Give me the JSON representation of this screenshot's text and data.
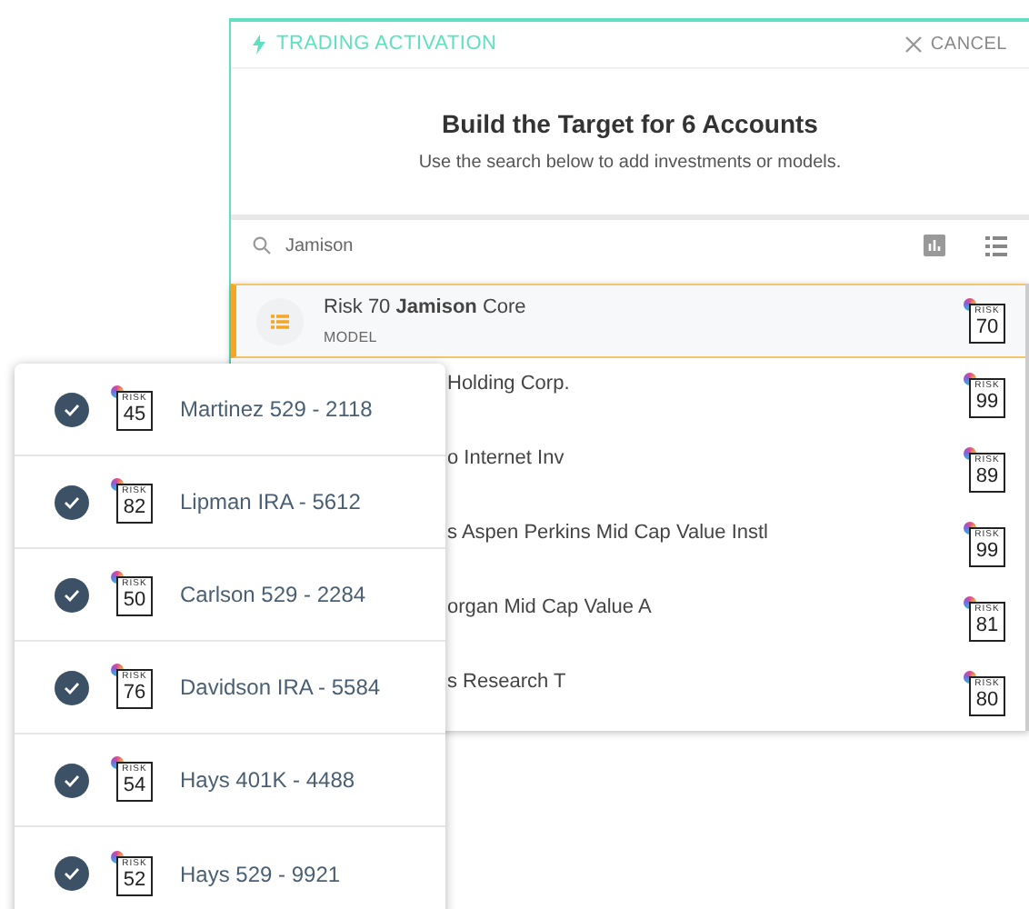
{
  "header": {
    "title": "TRADING ACTIVATION",
    "cancel": "CANCEL"
  },
  "heading": {
    "title": "Build the Target for 6 Accounts",
    "subtitle": "Use the search below to add investments or models."
  },
  "search": {
    "value": "Jamison"
  },
  "results": [
    {
      "name": "Risk 70 **Jamison** Core",
      "type": "MODEL",
      "selected": true,
      "risk_label": "RISK",
      "risk": "70"
    },
    {
      "name": "Holding Corp.",
      "selected": false,
      "risk_label": "RISK",
      "risk": "99"
    },
    {
      "name": "o Internet Inv",
      "selected": false,
      "risk_label": "RISK",
      "risk": "89"
    },
    {
      "name": "s Aspen Perkins Mid Cap Value Instl",
      "selected": false,
      "risk_label": "RISK",
      "risk": "99"
    },
    {
      "name": "organ Mid Cap Value A",
      "selected": false,
      "risk_label": "RISK",
      "risk": "81"
    },
    {
      "name": "s Research T",
      "selected": false,
      "risk_label": "RISK",
      "risk": "80"
    }
  ],
  "accounts": [
    {
      "name": "Martinez 529 - 2118",
      "checked": true,
      "risk_label": "RISK",
      "risk": "45"
    },
    {
      "name": "Lipman IRA - 5612",
      "checked": true,
      "risk_label": "RISK",
      "risk": "82"
    },
    {
      "name": "Carlson 529 - 2284",
      "checked": true,
      "risk_label": "RISK",
      "risk": "50"
    },
    {
      "name": "Davidson IRA - 5584",
      "checked": true,
      "risk_label": "RISK",
      "risk": "76"
    },
    {
      "name": "Hays 401K - 4488",
      "checked": true,
      "risk_label": "RISK",
      "risk": "54"
    },
    {
      "name": "Hays 529 - 9921",
      "checked": true,
      "risk_label": "RISK",
      "risk": "52"
    }
  ]
}
